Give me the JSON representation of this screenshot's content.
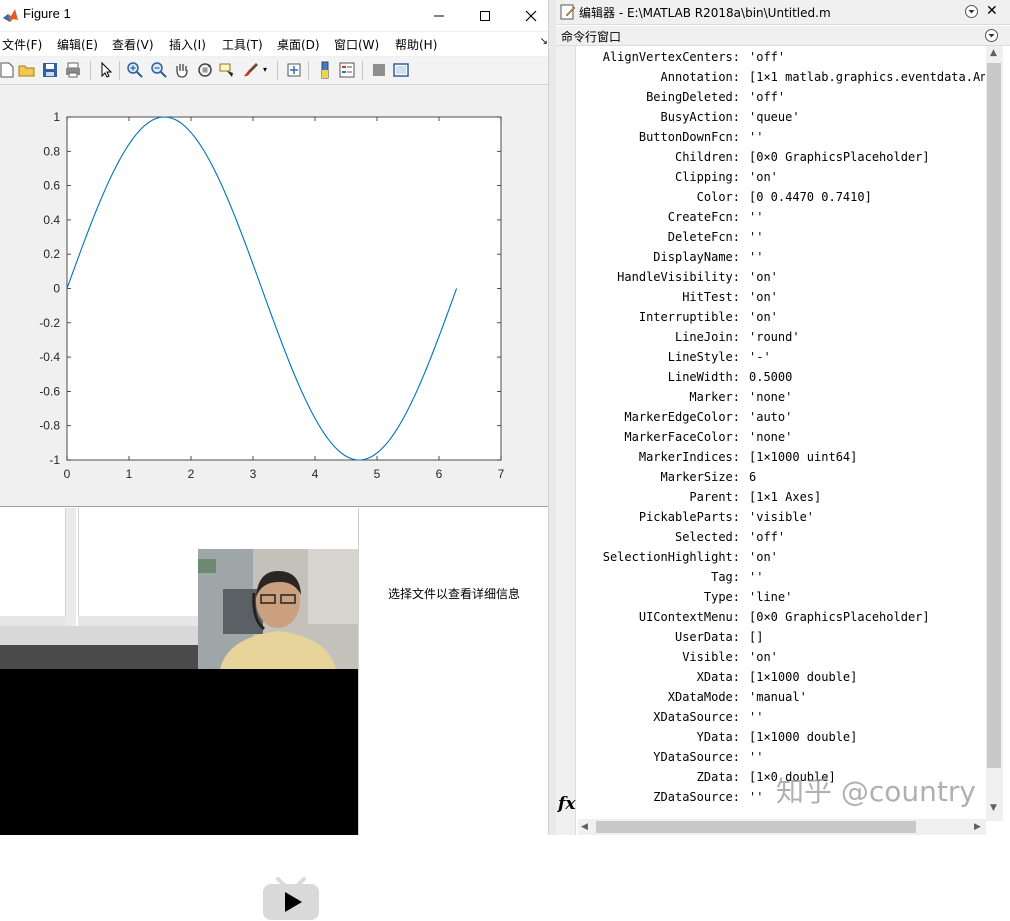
{
  "figure": {
    "title": "Figure 1",
    "menu": [
      "文件(F)",
      "编辑(E)",
      "查看(V)",
      "插入(I)",
      "工具(T)",
      "桌面(D)",
      "窗口(W)",
      "帮助(H)"
    ],
    "toolbar_icons": [
      "new-figure-icon",
      "open-icon",
      "save-icon",
      "print-icon",
      "select-arrow-icon",
      "zoom-in-icon",
      "zoom-out-icon",
      "pan-hand-icon",
      "rotate-3d-icon",
      "data-cursor-icon",
      "brush-icon",
      "link-plot-icon",
      "colorbar-icon",
      "legend-icon",
      "hide-plot-tools-icon",
      "show-plot-tools-icon"
    ]
  },
  "chart_data": {
    "type": "line",
    "series": [
      {
        "function": "sin(x)",
        "x": [
          0,
          0.5,
          1,
          1.5708,
          2,
          2.5,
          3,
          3.5,
          4,
          4.7124,
          5,
          5.5,
          6,
          6.2832
        ],
        "values": [
          0,
          0.479,
          0.841,
          1,
          0.909,
          0.598,
          0.141,
          -0.351,
          -0.757,
          -1,
          -0.959,
          -0.706,
          -0.279,
          0
        ],
        "color": "#0072BD"
      }
    ],
    "xlim": [
      0,
      7
    ],
    "ylim": [
      -1,
      1
    ],
    "xticks": [
      "0",
      "1",
      "2",
      "3",
      "4",
      "5",
      "6",
      "7"
    ],
    "yticks": [
      "1",
      "0.8",
      "0.6",
      "0.4",
      "0.2",
      "0",
      "-0.2",
      "-0.4",
      "-0.6",
      "-0.8",
      "-1"
    ],
    "grid": false
  },
  "file_browser": {
    "details_hint": "选择文件以查看详细信息"
  },
  "editor": {
    "title": "编辑器 - E:\\MATLAB R2018a\\bin\\Untitled.m",
    "command_window_title": "命令行窗口",
    "prompt_icon": "fx",
    "properties": [
      {
        "name": "AlignVertexCenters:",
        "value": "'off'"
      },
      {
        "name": "Annotation:",
        "value": "[1×1 matlab.graphics.eventdata.An"
      },
      {
        "name": "BeingDeleted:",
        "value": "'off'"
      },
      {
        "name": "BusyAction:",
        "value": "'queue'"
      },
      {
        "name": "ButtonDownFcn:",
        "value": "''"
      },
      {
        "name": "Children:",
        "value": "[0×0 GraphicsPlaceholder]"
      },
      {
        "name": "Clipping:",
        "value": "'on'"
      },
      {
        "name": "Color:",
        "value": "[0 0.4470 0.7410]"
      },
      {
        "name": "CreateFcn:",
        "value": "''"
      },
      {
        "name": "DeleteFcn:",
        "value": "''"
      },
      {
        "name": "DisplayName:",
        "value": "''"
      },
      {
        "name": "HandleVisibility:",
        "value": "'on'"
      },
      {
        "name": "HitTest:",
        "value": "'on'"
      },
      {
        "name": "Interruptible:",
        "value": "'on'"
      },
      {
        "name": "LineJoin:",
        "value": "'round'"
      },
      {
        "name": "LineStyle:",
        "value": "'-'"
      },
      {
        "name": "LineWidth:",
        "value": "0.5000"
      },
      {
        "name": "Marker:",
        "value": "'none'"
      },
      {
        "name": "MarkerEdgeColor:",
        "value": "'auto'"
      },
      {
        "name": "MarkerFaceColor:",
        "value": "'none'"
      },
      {
        "name": "MarkerIndices:",
        "value": "[1×1000 uint64]"
      },
      {
        "name": "MarkerSize:",
        "value": "6"
      },
      {
        "name": "Parent:",
        "value": "[1×1 Axes]"
      },
      {
        "name": "PickableParts:",
        "value": "'visible'"
      },
      {
        "name": "Selected:",
        "value": "'off'"
      },
      {
        "name": "SelectionHighlight:",
        "value": "'on'"
      },
      {
        "name": "Tag:",
        "value": "''"
      },
      {
        "name": "Type:",
        "value": "'line'"
      },
      {
        "name": "UIContextMenu:",
        "value": "[0×0 GraphicsPlaceholder]"
      },
      {
        "name": "UserData:",
        "value": "[]"
      },
      {
        "name": "Visible:",
        "value": "'on'"
      },
      {
        "name": "XData:",
        "value": "[1×1000 double]"
      },
      {
        "name": "XDataMode:",
        "value": "'manual'"
      },
      {
        "name": "XDataSource:",
        "value": "''"
      },
      {
        "name": "YData:",
        "value": "[1×1000 double]"
      },
      {
        "name": "YDataSource:",
        "value": "''"
      },
      {
        "name": "ZData:",
        "value": "[1×0 double]"
      },
      {
        "name": "ZDataSource:",
        "value": "''"
      }
    ]
  },
  "watermark": "知乎 @country"
}
